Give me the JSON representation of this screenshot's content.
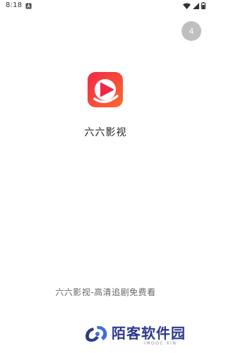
{
  "status_bar": {
    "time": "8:18",
    "icons": [
      "notification-a-icon",
      "wifi-icon",
      "signal-icon",
      "battery-icon"
    ]
  },
  "skip": {
    "countdown": "4"
  },
  "app": {
    "name": "六六影视",
    "logo_icon": "play-icon",
    "logo_colors": [
      "#f0284a",
      "#ff6a2c"
    ]
  },
  "slogan": "六六影视-高清追剧免费看",
  "watermark": {
    "text": "陌客软件园",
    "sub": "IMOOC XIN",
    "color": "#2d3a8c"
  }
}
